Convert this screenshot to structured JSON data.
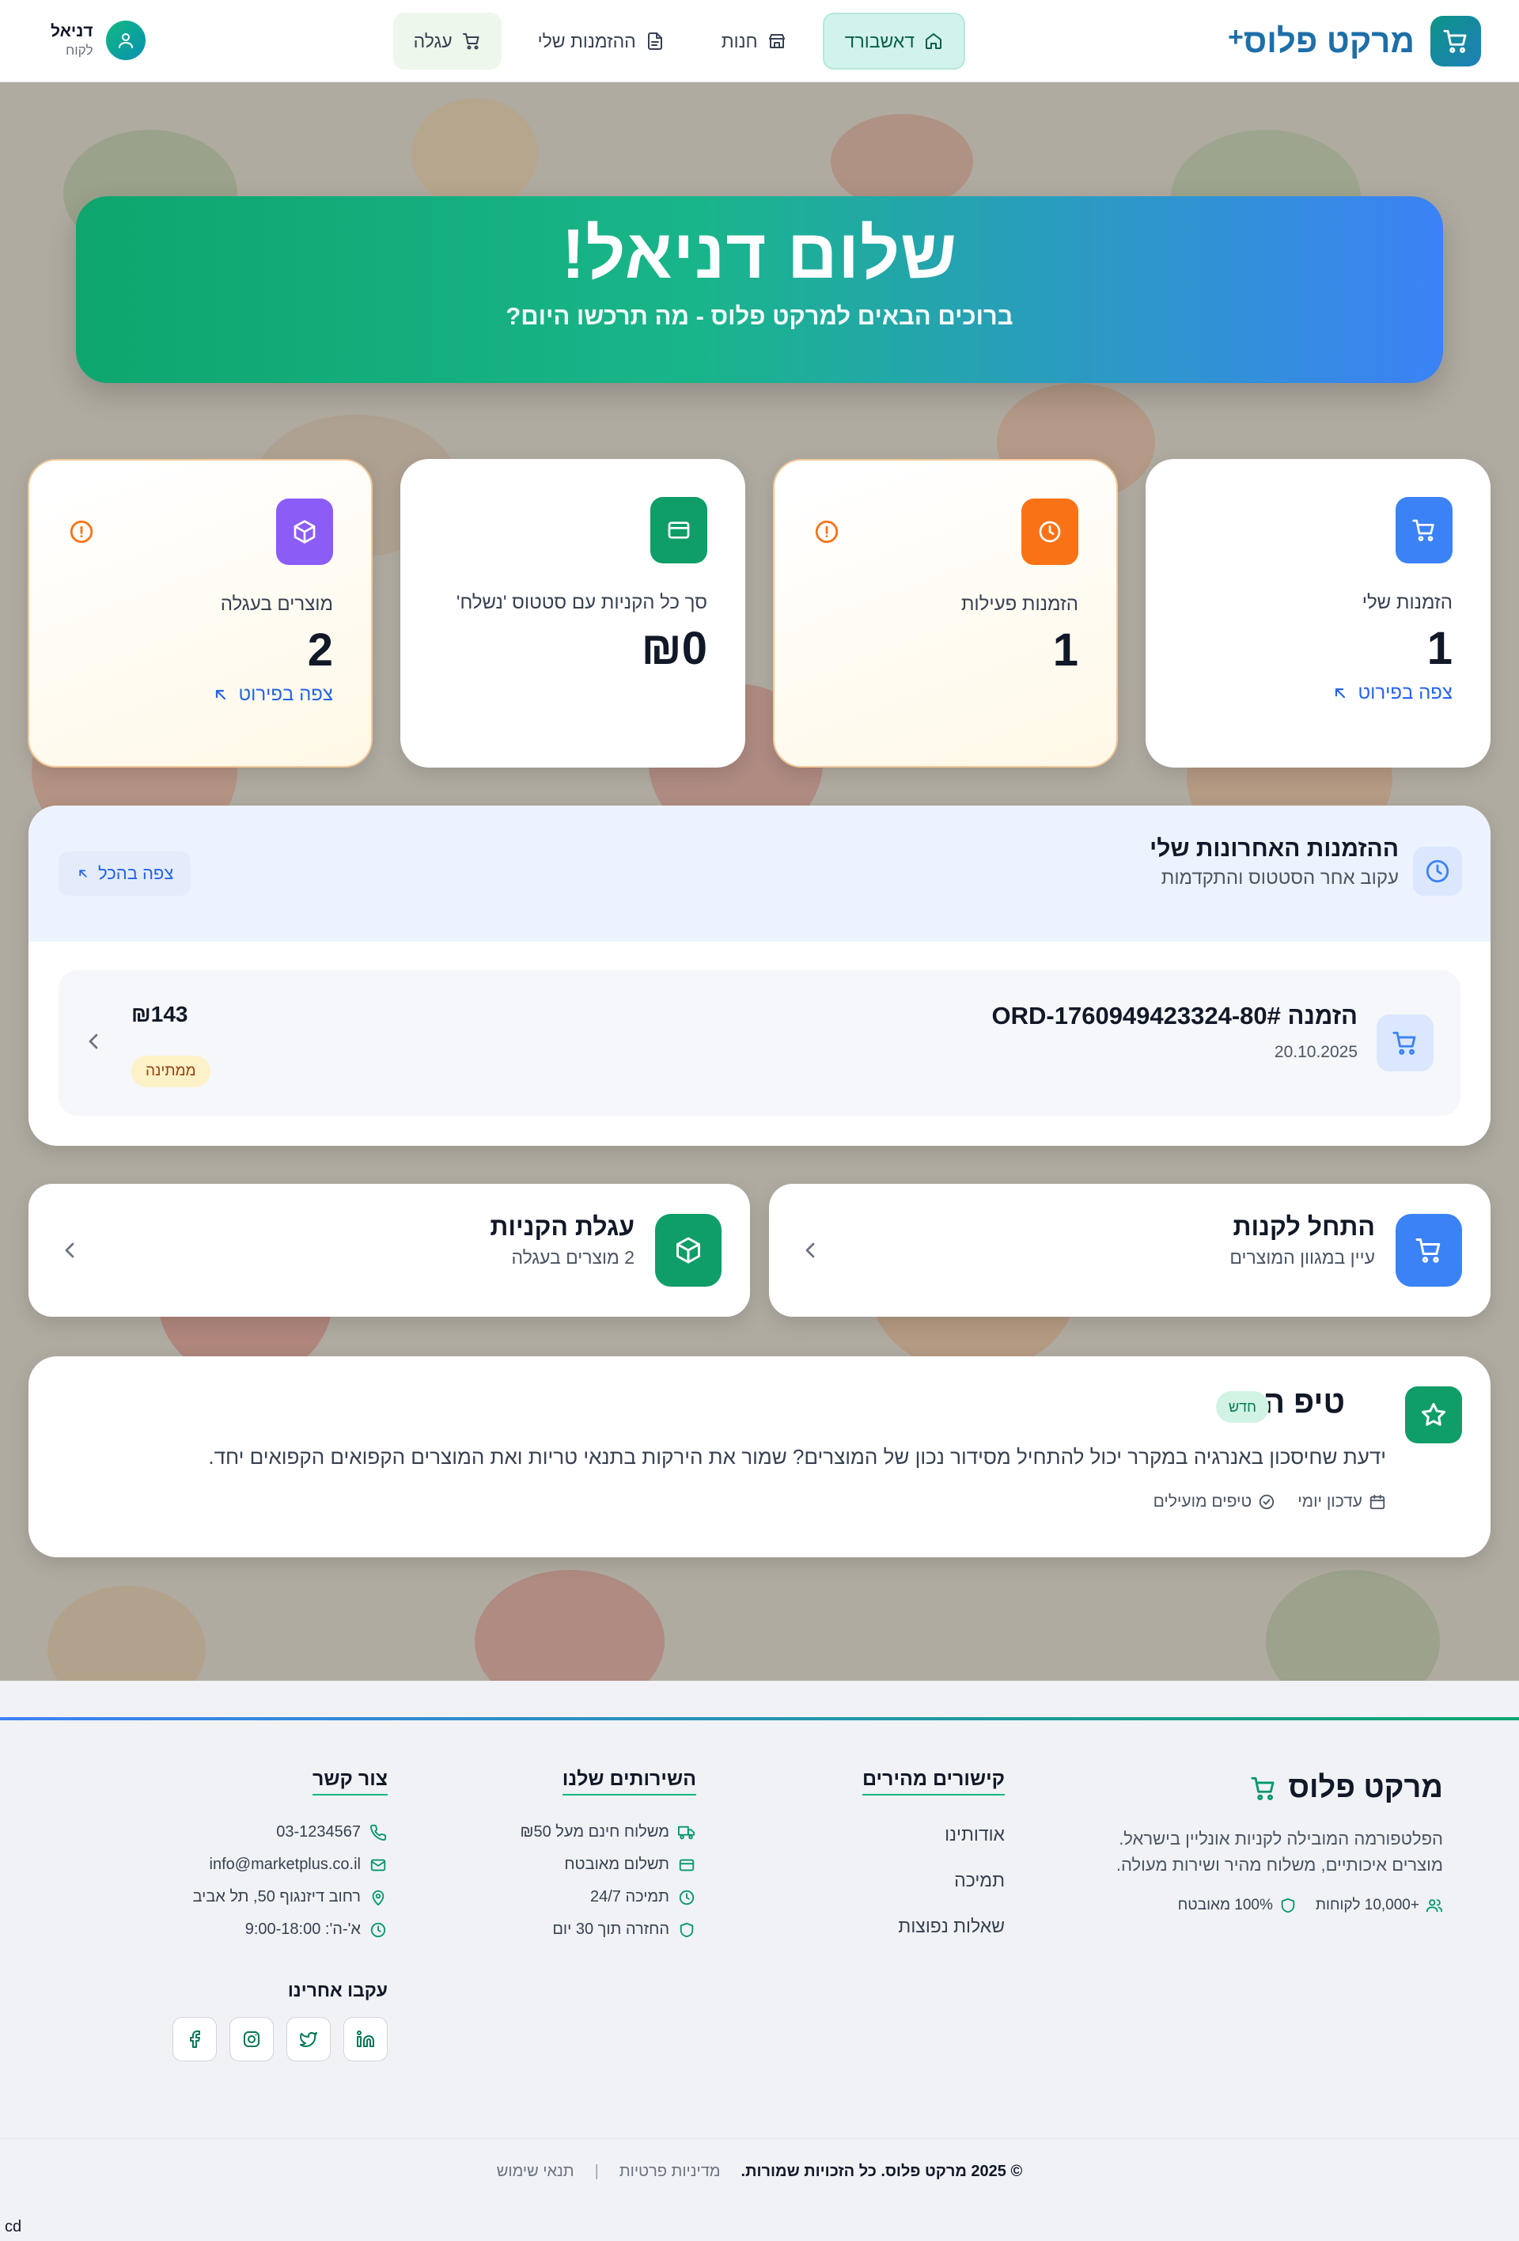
{
  "header": {
    "logo_text": "מרקט פלוס",
    "logo_plus": "+",
    "nav": [
      {
        "label": "דאשבורד",
        "icon": "home-icon",
        "active": true
      },
      {
        "label": "חנות",
        "icon": "store-icon"
      },
      {
        "label": "ההזמנות שלי",
        "icon": "document-icon"
      },
      {
        "label": "עגלה",
        "icon": "cart-icon"
      }
    ],
    "user": {
      "name": "דניאל",
      "role": "לקוח",
      "icon": "user-icon"
    }
  },
  "hero": {
    "title": "שלום דניאל!",
    "subtitle": "ברוכים הבאים למרקט פלוס - מה תרכשו היום?"
  },
  "stats": [
    {
      "label": "הזמנות שלי",
      "value": "1",
      "link": "צפה בפירוט",
      "icon": "cart-icon",
      "color": "#3b82f6"
    },
    {
      "label": "הזמנות פעילות",
      "value": "1",
      "icon": "clock-icon",
      "color": "#f97316",
      "alert_icon": "alert-circle-icon"
    },
    {
      "label": "סך כל הקניות עם סטטוס 'נשלח'",
      "value": "₪0",
      "icon": "credit-card-icon",
      "color": "#0f9d68"
    },
    {
      "label": "מוצרים בעגלה",
      "value": "2",
      "link": "צפה בפירוט",
      "icon": "package-icon",
      "color": "#8b5cf6",
      "alert_icon": "alert-circle-icon"
    }
  ],
  "recent_orders": {
    "title": "ההזמנות האחרונות שלי",
    "subtitle": "עקוב אחר הסטטוס והתקדמות",
    "view_all": "צפה בהכל",
    "orders": [
      {
        "id": "הזמנה #ORD-1760949423324-80",
        "date": "20.10.2025",
        "price": "₪143",
        "status": "ממתינה"
      }
    ]
  },
  "actions": [
    {
      "title": "התחל לקנות",
      "subtitle": "עיין במגוון המוצרים",
      "icon": "cart-icon",
      "color": "#3b82f6"
    },
    {
      "title": "עגלת הקניות",
      "subtitle": "2 מוצרים בעגלה",
      "icon": "package-icon",
      "color": "#0f9d68"
    }
  ],
  "tip": {
    "title": "טיפ היום",
    "badge": "חדש",
    "text": "ידעת שחיסכון באנרגיה במקרר יכול להתחיל מסידור נכון של המוצרים? שמור את הירקות בתנאי טריות ואת המוצרים הקפואים הקפואים יחד.",
    "meta": [
      "עדכון יומי",
      "טיפים מועילים"
    ]
  },
  "footer": {
    "brand": "מרקט פלוס",
    "description_1": "הפלטפורמה המובילה לקניות אונליין בישראל.",
    "description_2": "מוצרים איכותיים, משלוח מהיר ושירות מעולה.",
    "stat_customers": "+10,000 לקוחות",
    "stat_secure": "100% מאובטח",
    "quick_links_title": "קישורים מהירים",
    "quick_links": [
      "אודותינו",
      "תמיכה",
      "שאלות נפוצות"
    ],
    "services_title": "השירותים שלנו",
    "services": [
      {
        "label": "משלוח חינם מעל ₪50",
        "icon": "truck-icon"
      },
      {
        "label": "תשלום מאובטח",
        "icon": "credit-card-icon"
      },
      {
        "label": "תמיכה 24/7",
        "icon": "clock-icon"
      },
      {
        "label": "החזרה תוך 30 יום",
        "icon": "shield-icon"
      }
    ],
    "contact_title": "צור קשר",
    "contact": [
      {
        "label": "03-1234567",
        "icon": "phone-icon"
      },
      {
        "label": "info@marketplus.co.il",
        "icon": "mail-icon"
      },
      {
        "label": "רחוב דיזנגוף 50, תל אביב",
        "icon": "map-pin-icon"
      },
      {
        "label": "א'-ה': 9:00-18:00",
        "icon": "clock-icon"
      }
    ],
    "follow_title": "עקבו אחרינו",
    "social": [
      "linkedin-icon",
      "twitter-icon",
      "instagram-icon",
      "facebook-icon"
    ],
    "copyright": "© 2025 מרקט פלוס. כל הזכויות שמורות.",
    "privacy": "מדיניות פרטיות",
    "separator": "|",
    "terms": "תנאי שימוש"
  },
  "corner_text": "cd"
}
